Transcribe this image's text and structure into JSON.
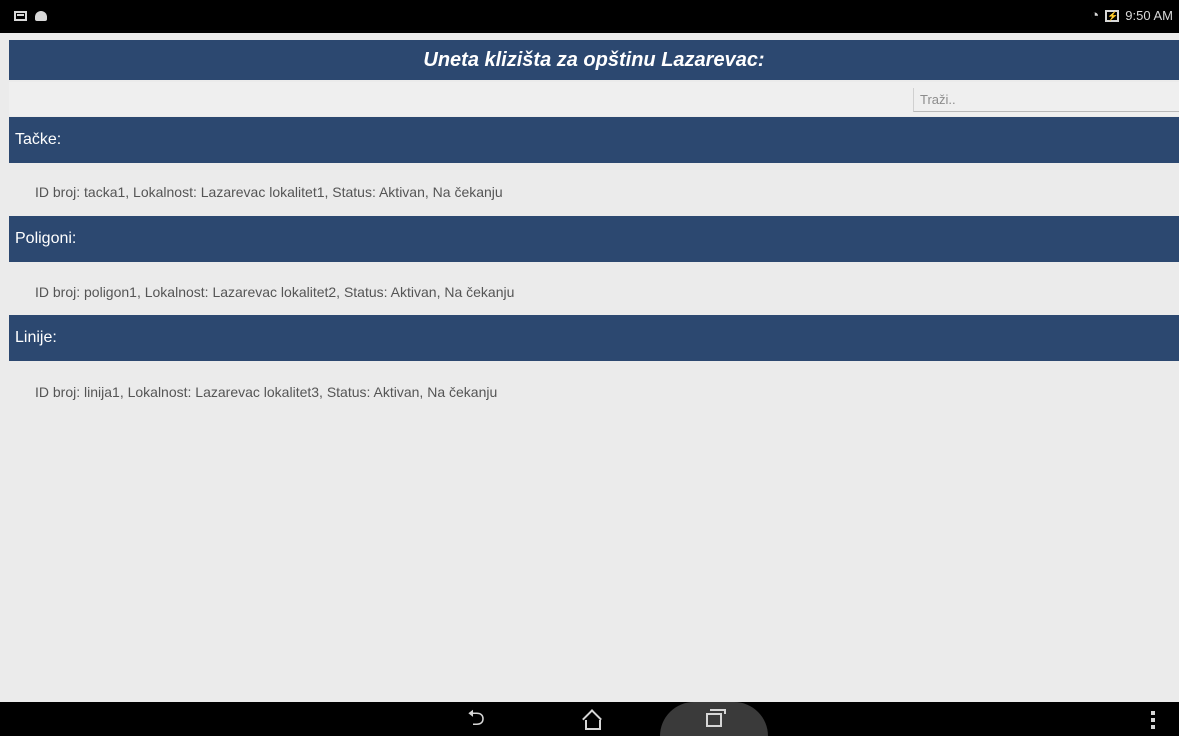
{
  "status_bar": {
    "left_icons": [
      "message-icon",
      "android-icon"
    ],
    "right_icons": [
      "wifi-icon",
      "battery-charging-icon"
    ],
    "time": "9:50 AM"
  },
  "header": {
    "title": "Uneta klizišta za opštinu Lazarevac:"
  },
  "search": {
    "placeholder": "Traži..",
    "value": ""
  },
  "sections": [
    {
      "title": "Tačke:",
      "items": [
        "ID broj: tacka1, Lokalnost: Lazarevac lokalitet1, Status: Aktivan, Na čekanju"
      ]
    },
    {
      "title": "Poligoni:",
      "items": [
        "ID broj: poligon1, Lokalnost: Lazarevac lokalitet2, Status: Aktivan, Na čekanju"
      ]
    },
    {
      "title": "Linije:",
      "items": [
        "ID broj: linija1, Lokalnost: Lazarevac lokalitet3, Status: Aktivan, Na čekanju"
      ]
    }
  ],
  "nav_bar": {
    "buttons": [
      "back-icon",
      "home-icon",
      "recent-apps-icon",
      "overflow-menu-icon"
    ]
  },
  "colors": {
    "header_bg": "#2c4870",
    "page_bg": "#ebebeb",
    "system_bar_bg": "#000000"
  }
}
